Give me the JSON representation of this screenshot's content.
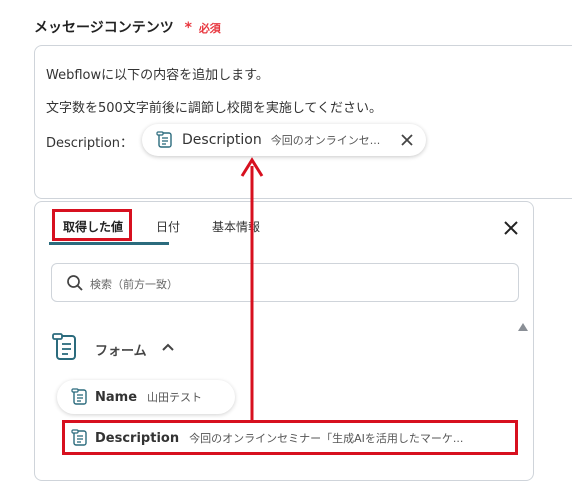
{
  "field": {
    "label": "メッセージコンテンツ",
    "required_star": "*",
    "required_text": "必須"
  },
  "message": {
    "line1": "Webflowに以下の内容を追加します。",
    "line2": "文字数を500文字前後に調節し校閲を実施してください。",
    "description_prefix": "Description："
  },
  "chip": {
    "name": "Description",
    "preview": "今回のオンラインセ..."
  },
  "dropdown": {
    "tabs": [
      {
        "label": "取得した値",
        "active": true
      },
      {
        "label": "日付",
        "active": false
      },
      {
        "label": "基本情報",
        "active": false
      }
    ],
    "search": {
      "placeholder": "検索（前方一致）"
    },
    "group": {
      "label": "フォーム"
    },
    "items": [
      {
        "name": "Name",
        "value": "山田テスト"
      },
      {
        "name": "Description",
        "value": "今回のオンラインセミナー「生成AIを活用したマーケ..."
      }
    ]
  },
  "colors": {
    "accent": "#2b6b7d",
    "highlight": "#d7101f",
    "required": "#e8373f"
  }
}
